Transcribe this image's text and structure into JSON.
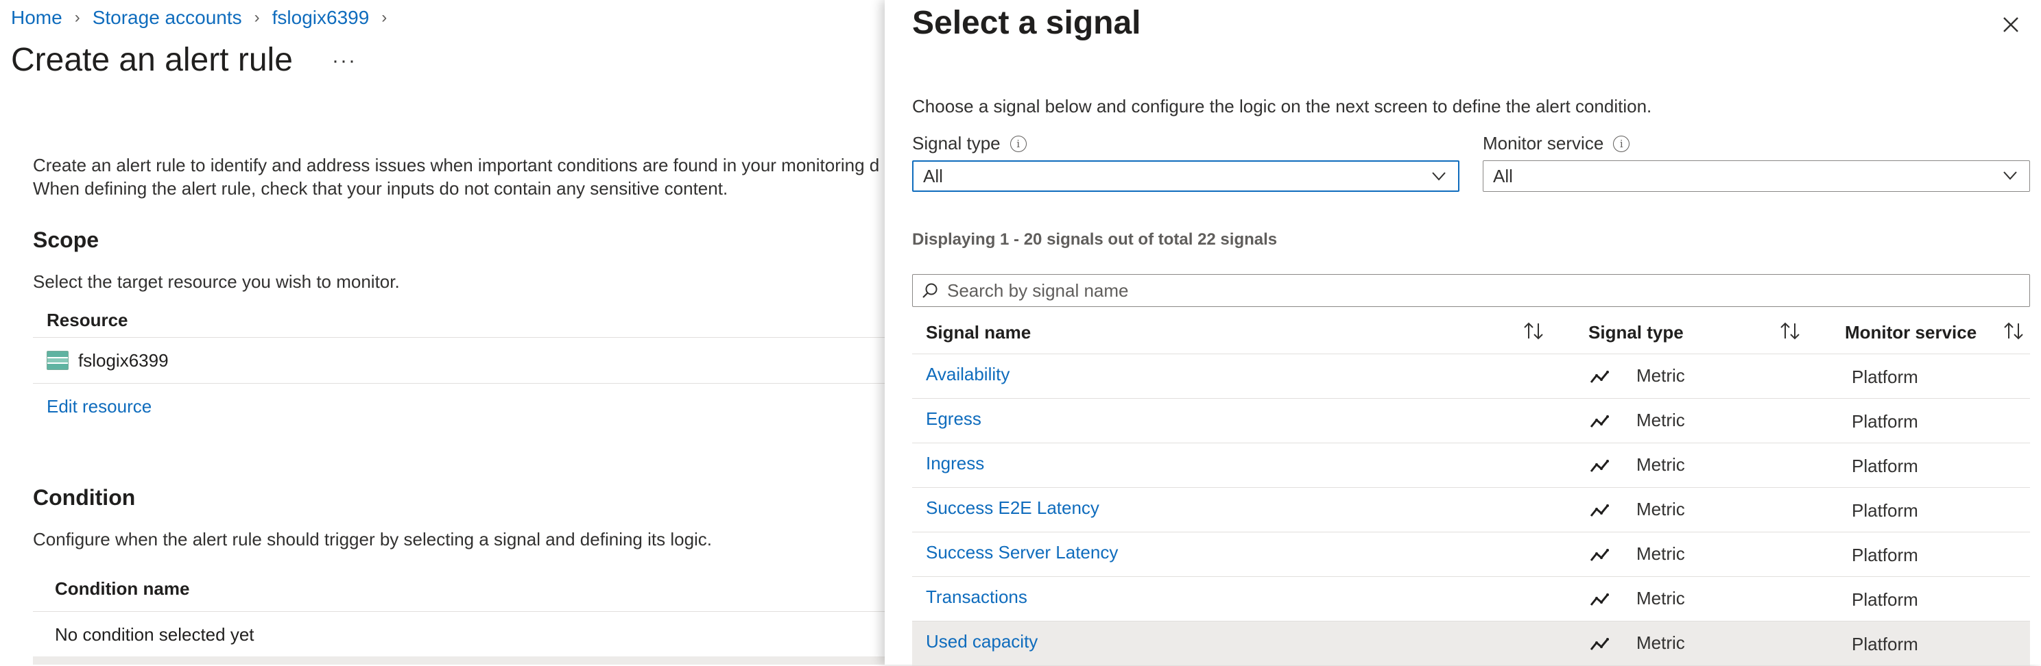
{
  "breadcrumb": [
    "Home",
    "Storage accounts",
    "fslogix6399"
  ],
  "page": {
    "title": "Create an alert rule",
    "more": "···",
    "description_line1": "Create an alert rule to identify and address issues when important conditions are found in your monitoring d",
    "description_line2": "When defining the alert rule, check that your inputs do not contain any sensitive content."
  },
  "scope": {
    "title": "Scope",
    "description": "Select the target resource you wish to monitor.",
    "column_header": "Resource",
    "resource_name": "fslogix6399",
    "edit_link": "Edit resource"
  },
  "condition": {
    "title": "Condition",
    "description": "Configure when the alert rule should trigger by selecting a signal and defining its logic.",
    "column_header": "Condition name",
    "empty_text": "No condition selected yet"
  },
  "panel": {
    "title": "Select a signal",
    "description": "Choose a signal below and configure the logic on the next screen to define the alert condition.",
    "signal_type_label": "Signal type",
    "signal_type_value": "All",
    "monitor_service_label": "Monitor service",
    "monitor_service_value": "All",
    "count_text": "Displaying 1 - 20 signals out of total 22 signals",
    "search_placeholder": "Search by signal name",
    "columns": {
      "signal_name": "Signal name",
      "signal_type": "Signal type",
      "monitor_service": "Monitor service"
    },
    "rows": [
      {
        "name": "Availability",
        "type": "Metric",
        "service": "Platform"
      },
      {
        "name": "Egress",
        "type": "Metric",
        "service": "Platform"
      },
      {
        "name": "Ingress",
        "type": "Metric",
        "service": "Platform"
      },
      {
        "name": "Success E2E Latency",
        "type": "Metric",
        "service": "Platform"
      },
      {
        "name": "Success Server Latency",
        "type": "Metric",
        "service": "Platform"
      },
      {
        "name": "Transactions",
        "type": "Metric",
        "service": "Platform"
      },
      {
        "name": "Used capacity",
        "type": "Metric",
        "service": "Platform"
      }
    ]
  },
  "colors": {
    "link": "#0f6cbd",
    "selected_row": "#edebe9",
    "border": "#e1dfdd"
  },
  "icons": [
    "chevron-right-icon",
    "more-icon",
    "storage-account-icon",
    "close-icon",
    "info-icon",
    "chevron-down-icon",
    "search-icon",
    "sort-icon",
    "metric-icon"
  ]
}
